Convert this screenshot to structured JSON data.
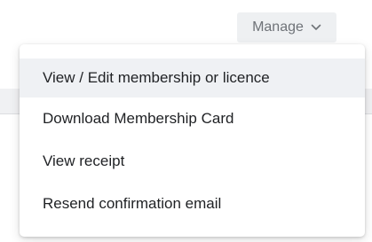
{
  "manage": {
    "label": "Manage",
    "icon": "chevron-down-icon"
  },
  "menu": {
    "items": [
      {
        "label": "View / Edit membership or licence",
        "active": true
      },
      {
        "label": "Download Membership Card",
        "active": false
      },
      {
        "label": "View receipt",
        "active": false
      },
      {
        "label": "Resend confirmation email",
        "active": false
      }
    ]
  },
  "colors": {
    "menu_text": "#1f2124",
    "muted_text": "#6f7378",
    "active_background": "#eff1f4"
  }
}
